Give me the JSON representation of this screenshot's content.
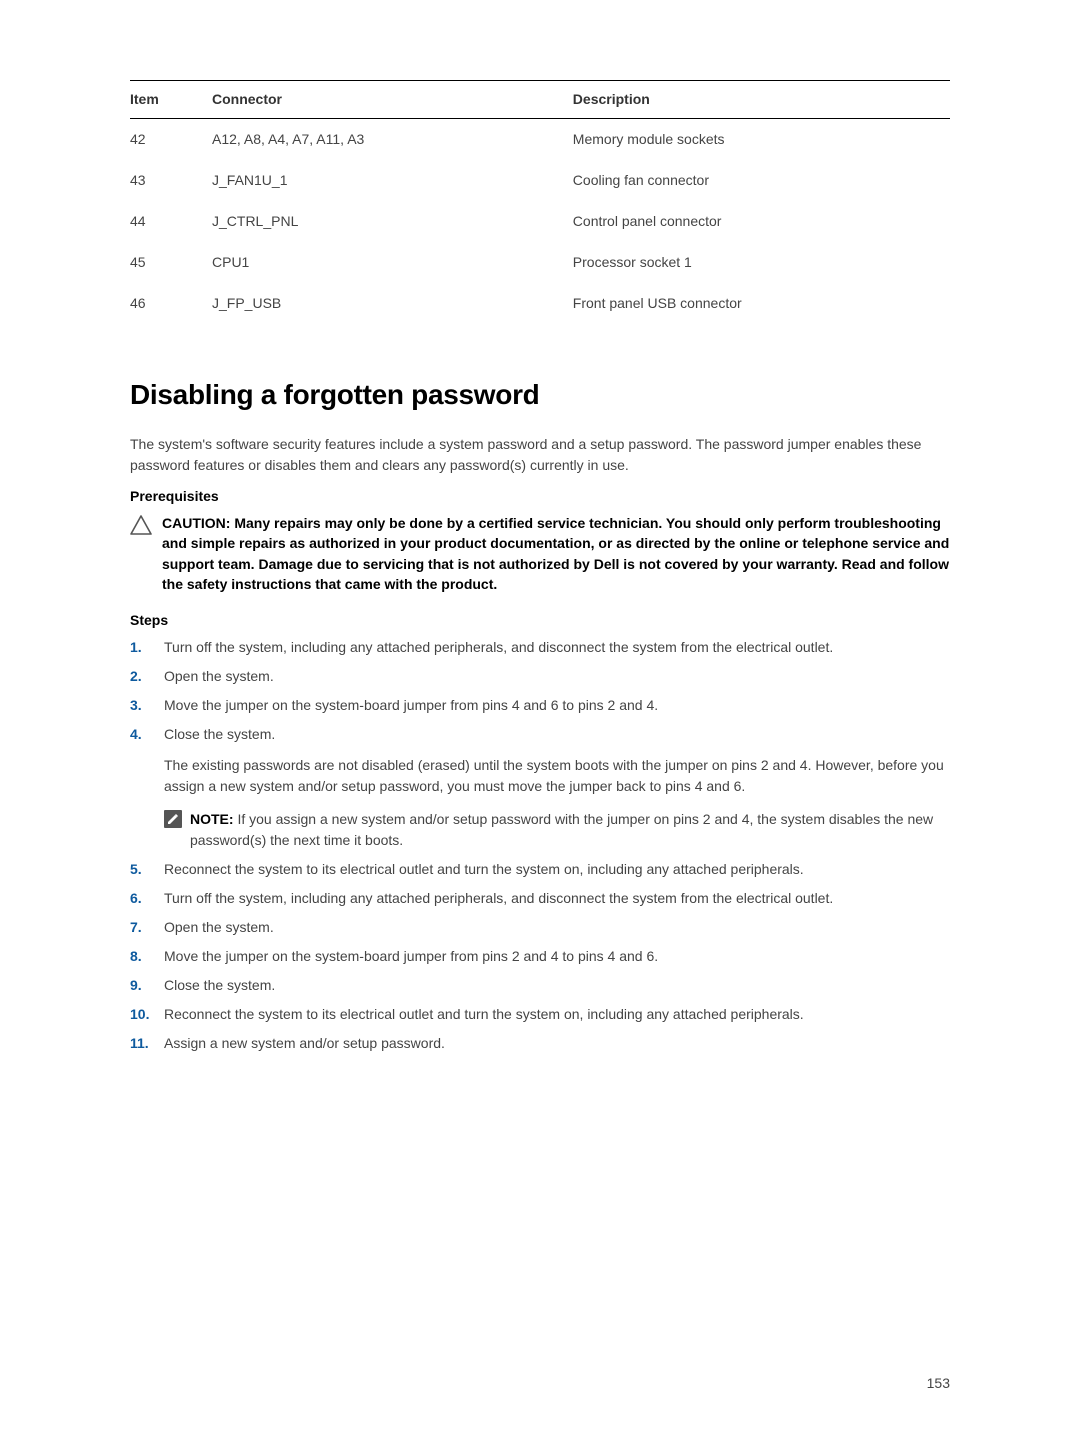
{
  "table": {
    "headers": {
      "item": "Item",
      "connector": "Connector",
      "description": "Description"
    },
    "rows": [
      {
        "item": "42",
        "connector": "A12, A8, A4, A7, A11, A3",
        "description": "Memory module sockets"
      },
      {
        "item": "43",
        "connector": "J_FAN1U_1",
        "description": "Cooling fan connector"
      },
      {
        "item": "44",
        "connector": "J_CTRL_PNL",
        "description": "Control panel connector"
      },
      {
        "item": "45",
        "connector": "CPU1",
        "description": "Processor socket 1"
      },
      {
        "item": "46",
        "connector": "J_FP_USB",
        "description": "Front panel USB connector"
      }
    ]
  },
  "heading": "Disabling a forgotten password",
  "intro": "The system's software security features include a system password and a setup password. The password jumper enables these password features or disables them and clears any password(s) currently in use.",
  "prerequisites_label": "Prerequisites",
  "caution": "CAUTION: Many repairs may only be done by a certified service technician. You should only perform troubleshooting and simple repairs as authorized in your product documentation, or as directed by the online or telephone service and support team. Damage due to servicing that is not authorized by Dell is not covered by your warranty. Read and follow the safety instructions that came with the product.",
  "steps_label": "Steps",
  "steps": [
    {
      "num": "1.",
      "text": "Turn off the system, including any attached peripherals, and disconnect the system from the electrical outlet."
    },
    {
      "num": "2.",
      "text": "Open the system."
    },
    {
      "num": "3.",
      "text": "Move the jumper on the system-board jumper from pins 4 and 6 to pins 2 and 4."
    },
    {
      "num": "4.",
      "text": "Close the system.",
      "extra": "The existing passwords are not disabled (erased) until the system boots with the jumper on pins 2 and 4. However, before you assign a new system and/or setup password, you must move the jumper back to pins 4 and 6.",
      "note_label": "NOTE:",
      "note": " If you assign a new system and/or setup password with the jumper on pins 2 and 4, the system disables the new password(s) the next time it boots."
    },
    {
      "num": "5.",
      "text": "Reconnect the system to its electrical outlet and turn the system on, including any attached peripherals."
    },
    {
      "num": "6.",
      "text": "Turn off the system, including any attached peripherals, and disconnect the system from the electrical outlet."
    },
    {
      "num": "7.",
      "text": "Open the system."
    },
    {
      "num": "8.",
      "text": "Move the jumper on the system-board jumper from pins 2 and 4 to pins 4 and 6."
    },
    {
      "num": "9.",
      "text": "Close the system."
    },
    {
      "num": "10.",
      "text": "Reconnect the system to its electrical outlet and turn the system on, including any attached peripherals."
    },
    {
      "num": "11.",
      "text": "Assign a new system and/or setup password."
    }
  ],
  "page_number": "153"
}
